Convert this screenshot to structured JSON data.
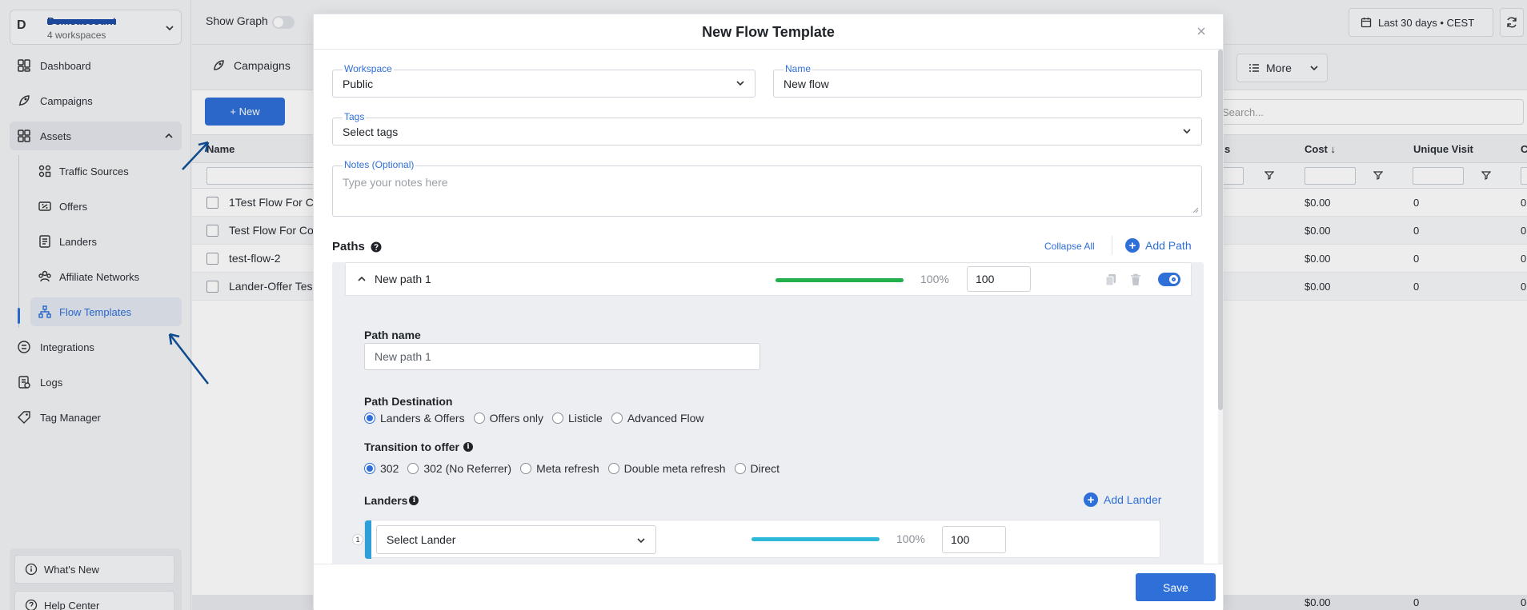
{
  "sidebar": {
    "workspace_initial": "D",
    "workspace_name": "Demoaccount",
    "workspace_count": "4 workspaces",
    "nav": {
      "dashboard": "Dashboard",
      "campaigns": "Campaigns",
      "assets": "Assets",
      "integrations": "Integrations",
      "logs": "Logs",
      "tag_manager": "Tag Manager"
    },
    "assets_sub": {
      "traffic_sources": "Traffic Sources",
      "offers": "Offers",
      "landers": "Landers",
      "affiliate_networks": "Affiliate Networks",
      "flow_templates": "Flow Templates"
    },
    "bottom": {
      "whats_new": "What's New",
      "help_center": "Help Center"
    }
  },
  "topbar": {
    "show_graph": "Show Graph",
    "date_range": "Last 30 days • CEST"
  },
  "page": {
    "tab": "Campaigns",
    "more": "More",
    "new_button": "+ New",
    "search_placeholder": "Search...",
    "columns": {
      "name": "Name",
      "col_s": "s",
      "cost": "Cost",
      "unique_visit": "Unique Visit",
      "col_c": "C"
    },
    "rows": [
      {
        "name": "1Test Flow For C",
        "cost": "$0.00",
        "uv": "0",
        "c": "0"
      },
      {
        "name": "Test Flow For Co",
        "cost": "$0.00",
        "uv": "0",
        "c": "0"
      },
      {
        "name": "test-flow-2",
        "cost": "$0.00",
        "uv": "0",
        "c": "0"
      },
      {
        "name": "Lander-Offer Tes",
        "cost": "$0.00",
        "uv": "0",
        "c": "0"
      }
    ],
    "footer": {
      "cost": "$0.00",
      "uv": "0",
      "c": "0"
    }
  },
  "modal": {
    "title": "New Flow Template",
    "workspace": {
      "label": "Workspace",
      "value": "Public"
    },
    "name": {
      "label": "Name",
      "value": "New flow"
    },
    "tags": {
      "label": "Tags",
      "placeholder": "Select tags"
    },
    "notes": {
      "label": "Notes (Optional)",
      "placeholder": "Type your notes here"
    },
    "paths_title": "Paths",
    "collapse_all": "Collapse All",
    "add_path": "Add Path",
    "path": {
      "name": "New path 1",
      "percent": "100%",
      "weight": "100",
      "weight_fraction": 1.0,
      "enabled": true,
      "path_name_label": "Path name",
      "path_name_value": "New path 1",
      "destination_label": "Path Destination",
      "destinations": [
        "Landers & Offers",
        "Offers only",
        "Listicle",
        "Advanced Flow"
      ],
      "destination_selected": "Landers & Offers",
      "transition_label": "Transition to offer",
      "transitions": [
        "302",
        "302 (No Referrer)",
        "Meta refresh",
        "Double meta refresh",
        "Direct"
      ],
      "transition_selected": "302",
      "landers_label": "Landers",
      "add_lander": "Add Lander",
      "lander": {
        "index": "1",
        "select_placeholder": "Select Lander",
        "percent": "100%",
        "weight": "100",
        "weight_fraction": 1.0
      }
    },
    "save": "Save"
  },
  "colors": {
    "accent": "#2e6fd8",
    "path_bar": "#22b04b",
    "lander_bar": "#2eb8d8"
  }
}
